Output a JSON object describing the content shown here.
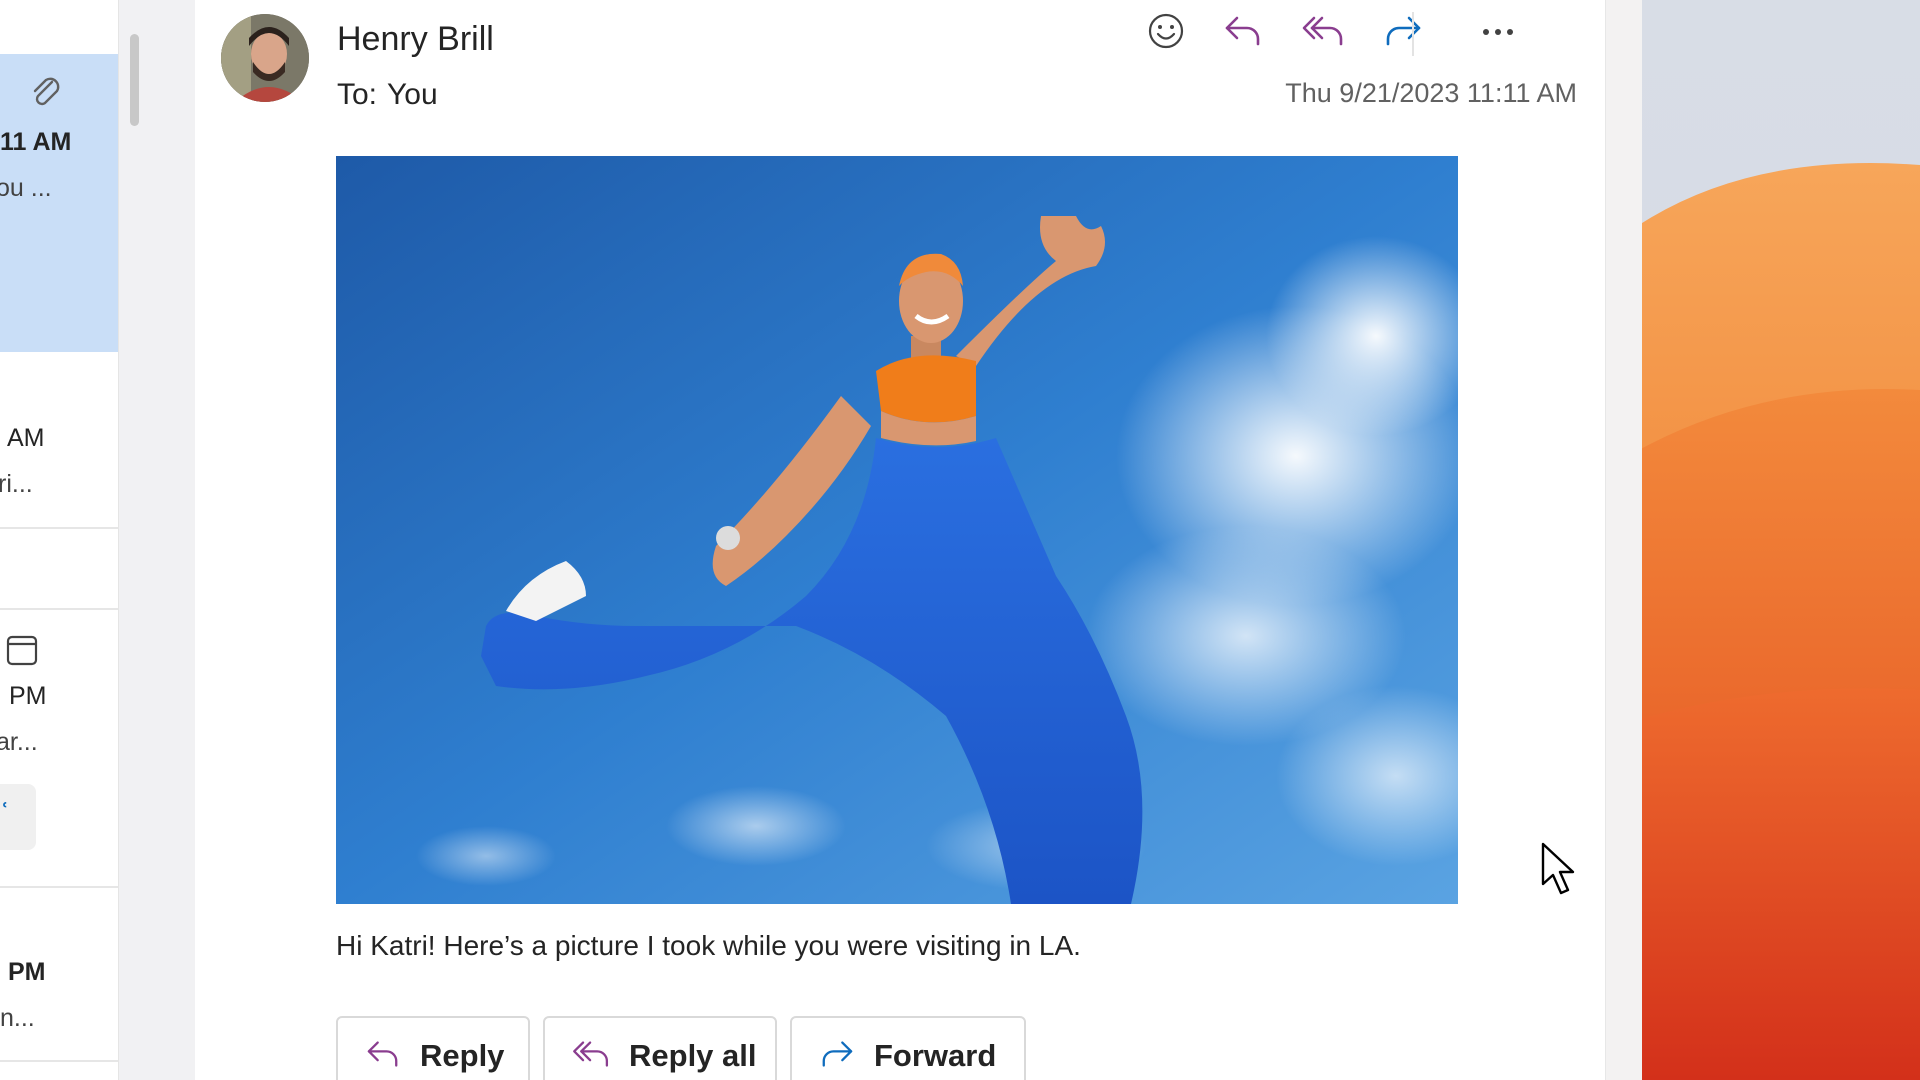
{
  "message_list": {
    "items": [
      {
        "time": "11 AM",
        "preview": "ou ...",
        "has_attachment": true,
        "selected": true
      },
      {
        "time": "AM",
        "preview": "ri...",
        "has_attachment": false,
        "selected": false
      },
      {
        "time": "PM",
        "preview": "ar...",
        "has_calendar": true,
        "selected": false
      },
      {
        "time": "PM",
        "preview": "n...",
        "selected": false
      }
    ]
  },
  "email": {
    "sender": "Henry Brill",
    "to_label": "To:",
    "to_value": "You",
    "timestamp": "Thu 9/21/2023 11:11 AM",
    "body": "Hi Katri! Here’s a picture I took while you were visiting in LA.",
    "toolbar": {
      "icons": [
        "emoji-icon",
        "reply-icon",
        "reply-all-icon",
        "forward-icon",
        "more-icon"
      ]
    },
    "actions": {
      "reply": "Reply",
      "reply_all": "Reply all",
      "forward": "Forward"
    }
  },
  "colors": {
    "accent": "#0f6cbd",
    "reply_purple": "#8a3d8f",
    "selected_bg": "#c9def7"
  }
}
